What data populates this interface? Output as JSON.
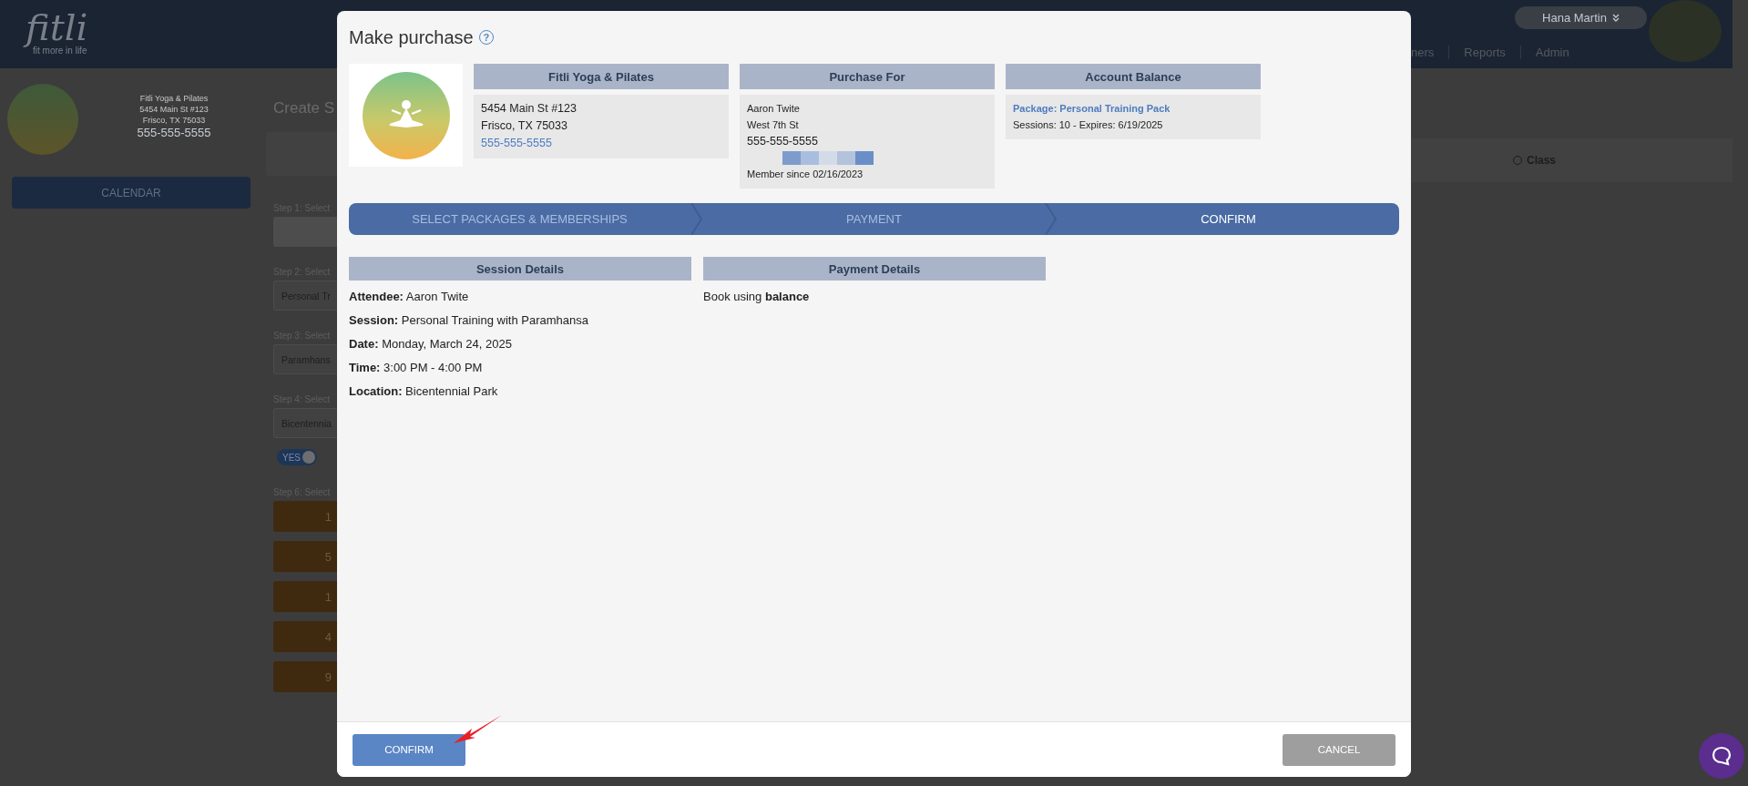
{
  "app_header": {
    "logo": "fitli",
    "tagline": "fit more in life",
    "user_menu": "Hana Martin",
    "nav": [
      "ners",
      "Reports",
      "Admin"
    ]
  },
  "studio": {
    "name": "Fitli Yoga & Pilates",
    "address_lines": [
      "5454 Main St #123",
      "Frisco, TX 75033"
    ],
    "phone": "555-555-5555"
  },
  "sidebar": {
    "button": "CALENDAR"
  },
  "main": {
    "title": "Create S",
    "type_options": [
      {
        "label": "Class",
        "selected": false
      }
    ],
    "form": [
      {
        "kind": "label",
        "text": "Step 1: Select"
      },
      {
        "kind": "bar"
      },
      {
        "kind": "label",
        "text": "Step 2: Select"
      },
      {
        "kind": "select",
        "value": "Personal Tr"
      },
      {
        "kind": "label",
        "text": "Step 3: Select"
      },
      {
        "kind": "select",
        "value": "Paramhans"
      },
      {
        "kind": "label",
        "text": "Step 4: Select"
      },
      {
        "kind": "select",
        "value": "Bicentennia"
      },
      {
        "kind": "toggle",
        "label": "YES",
        "on": true
      },
      {
        "kind": "label",
        "text": "Step 6: Select"
      },
      {
        "kind": "slot",
        "text": "1"
      },
      {
        "kind": "slot",
        "text": "5"
      },
      {
        "kind": "slot",
        "text": "1"
      },
      {
        "kind": "slot",
        "text": "4"
      },
      {
        "kind": "slot",
        "text": "9"
      }
    ]
  },
  "modal": {
    "title": "Make purchase",
    "help": "?",
    "cards": [
      {
        "heading": "Fitli Yoga & Pilates",
        "lines": [
          {
            "kind": "text",
            "text": "5454 Main St #123"
          },
          {
            "kind": "text",
            "text": "Frisco, TX 75033"
          },
          {
            "kind": "link",
            "text": "555-555-5555"
          }
        ]
      },
      {
        "heading": "Purchase For",
        "lines": [
          {
            "kind": "small",
            "text": "Aaron Twite"
          },
          {
            "kind": "small",
            "text": "West 7th St"
          },
          {
            "kind": "text",
            "text": "555-555-5555"
          },
          {
            "kind": "strip"
          },
          {
            "kind": "small",
            "text": "Member since 02/16/2023"
          }
        ]
      },
      {
        "heading": "Account Balance",
        "lines": [
          {
            "kind": "package",
            "text": "Package: Personal Training Pack"
          },
          {
            "kind": "small",
            "text": "Sessions: 10 -  Expires: 6/19/2025"
          }
        ]
      }
    ],
    "wizard_steps": [
      {
        "label": "SELECT PACKAGES & MEMBERSHIPS",
        "selected": false
      },
      {
        "label": "PAYMENT",
        "selected": false
      },
      {
        "label": "CONFIRM",
        "selected": true
      }
    ],
    "sections": [
      {
        "heading": "Session Details",
        "lines": [
          "**Attendee:** Aaron Twite",
          "**Session:** Personal Training with Paramhansa",
          "**Date:** Monday, March 24, 2025",
          "**Time:** 3:00 PM - 4:00 PM",
          "**Location:** Bicentennial Park"
        ]
      },
      {
        "heading": "Payment Details",
        "lines": [
          "Book using **balance**"
        ]
      }
    ],
    "buttons": [
      {
        "kind": "primary",
        "label": "CONFIRM"
      },
      {
        "kind": "secondary",
        "label": "CANCEL"
      }
    ]
  }
}
